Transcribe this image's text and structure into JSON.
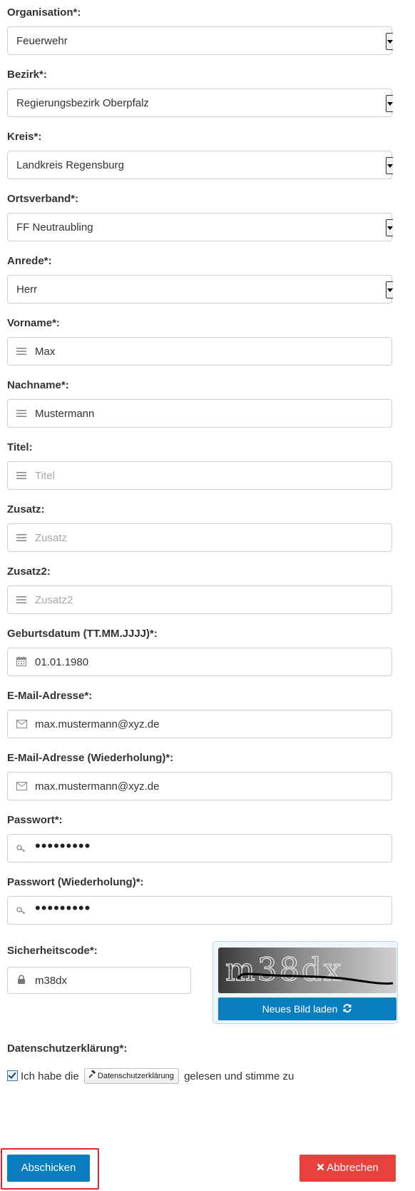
{
  "form": {
    "organisation": {
      "label": "Organisation*:",
      "value": "Feuerwehr"
    },
    "bezirk": {
      "label": "Bezirk*:",
      "value": "Regierungsbezirk Oberpfalz"
    },
    "kreis": {
      "label": "Kreis*:",
      "value": "Landkreis Regensburg"
    },
    "ortsverband": {
      "label": "Ortsverband*:",
      "value": "FF Neutraubling"
    },
    "anrede": {
      "label": "Anrede*:",
      "value": "Herr"
    },
    "vorname": {
      "label": "Vorname*:",
      "value": "Max"
    },
    "nachname": {
      "label": "Nachname*:",
      "value": "Mustermann"
    },
    "titel": {
      "label": "Titel:",
      "placeholder": "Titel"
    },
    "zusatz": {
      "label": "Zusatz:",
      "placeholder": "Zusatz"
    },
    "zusatz2": {
      "label": "Zusatz2:",
      "placeholder": "Zusatz2"
    },
    "geburtsdatum": {
      "label": "Geburtsdatum (TT.MM.JJJJ)*:",
      "value": "01.01.1980"
    },
    "email": {
      "label": "E-Mail-Adresse*:",
      "value": "max.mustermann@xyz.de"
    },
    "email_repeat": {
      "label": "E-Mail-Adresse (Wiederholung)*:",
      "value": "max.mustermann@xyz.de"
    },
    "passwort": {
      "label": "Passwort*:",
      "value": "•••••••••"
    },
    "passwort_repeat": {
      "label": "Passwort (Wiederholung)*:",
      "value": "•••••••••"
    },
    "sicherheitscode": {
      "label": "Sicherheitscode*:",
      "value": "m38dx"
    }
  },
  "captcha": {
    "image_text": "m38dx",
    "reload_label": "Neues Bild laden"
  },
  "consent": {
    "label": "Datenschutzerklärung*:",
    "prefix": "Ich habe die",
    "button_label": "Datenschutzerklärung",
    "suffix": "gelesen und stimme zu",
    "checked": true
  },
  "actions": {
    "submit_label": "Abschicken",
    "cancel_label": "Abbrechen"
  },
  "colors": {
    "primary": "#0a7dc1",
    "danger": "#e8403c",
    "highlight": "#e3262e"
  },
  "icons": {
    "text_field": "menu-lines-icon",
    "date_field": "calendar-icon",
    "email_field": "envelope-icon",
    "password_field": "key-icon",
    "captcha_field": "lock-icon",
    "reload": "refresh-icon",
    "privacy": "gavel-icon",
    "cancel": "times-icon"
  }
}
